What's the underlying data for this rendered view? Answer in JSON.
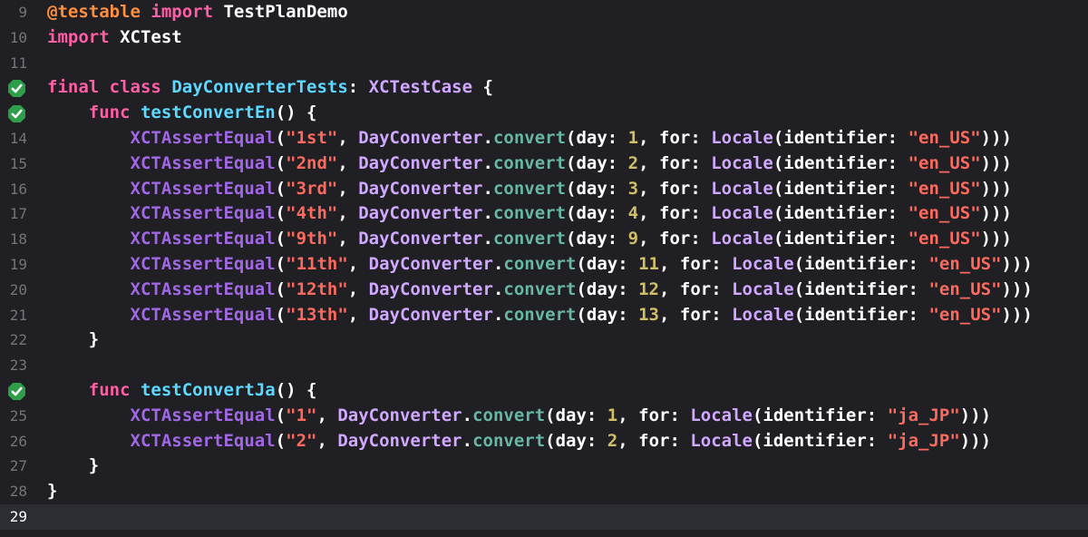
{
  "colors": {
    "keyword": "#fc5fa3",
    "attribute": "#fd8f3f",
    "type_decl": "#5dd8ff",
    "class_ref": "#d0a8ff",
    "method": "#67b7a4",
    "string": "#fc6a5d",
    "number": "#d0bf69",
    "library_fn": "#a167e6",
    "plain": "#ffffff",
    "test_pass_badge": "#2e9e4a"
  },
  "editor": {
    "current_line": 29,
    "lines": [
      {
        "n": "9",
        "tokens": [
          [
            "attr",
            "@testable"
          ],
          [
            "plain",
            " "
          ],
          [
            "kw",
            "import"
          ],
          [
            "plain",
            " TestPlanDemo"
          ]
        ]
      },
      {
        "n": "10",
        "tokens": [
          [
            "kw",
            "import"
          ],
          [
            "plain",
            " XCTest"
          ]
        ]
      },
      {
        "n": "11",
        "tokens": []
      },
      {
        "n": "12",
        "pass_icon": "test-passed-icon",
        "tokens": [
          [
            "kw",
            "final"
          ],
          [
            "plain",
            " "
          ],
          [
            "kw",
            "class"
          ],
          [
            "plain",
            " "
          ],
          [
            "type",
            "DayConverterTests"
          ],
          [
            "plain",
            ": "
          ],
          [
            "cls",
            "XCTestCase"
          ],
          [
            "plain",
            " {"
          ]
        ]
      },
      {
        "n": "13",
        "pass_icon": "test-passed-icon",
        "tokens": [
          [
            "plain",
            "    "
          ],
          [
            "kw",
            "func"
          ],
          [
            "plain",
            " "
          ],
          [
            "type",
            "testConvertEn"
          ],
          [
            "plain",
            "() {"
          ]
        ]
      },
      {
        "n": "14",
        "tokens": [
          [
            "plain",
            "        "
          ],
          [
            "lib",
            "XCTAssertEqual"
          ],
          [
            "plain",
            "("
          ],
          [
            "str",
            "\"1st\""
          ],
          [
            "plain",
            ", "
          ],
          [
            "cls",
            "DayConverter"
          ],
          [
            "plain",
            "."
          ],
          [
            "fn",
            "convert"
          ],
          [
            "plain",
            "(day: "
          ],
          [
            "num",
            "1"
          ],
          [
            "plain",
            ", for: "
          ],
          [
            "cls",
            "Locale"
          ],
          [
            "plain",
            "(identifier: "
          ],
          [
            "str",
            "\"en_US\""
          ],
          [
            "plain",
            ")))"
          ]
        ]
      },
      {
        "n": "15",
        "tokens": [
          [
            "plain",
            "        "
          ],
          [
            "lib",
            "XCTAssertEqual"
          ],
          [
            "plain",
            "("
          ],
          [
            "str",
            "\"2nd\""
          ],
          [
            "plain",
            ", "
          ],
          [
            "cls",
            "DayConverter"
          ],
          [
            "plain",
            "."
          ],
          [
            "fn",
            "convert"
          ],
          [
            "plain",
            "(day: "
          ],
          [
            "num",
            "2"
          ],
          [
            "plain",
            ", for: "
          ],
          [
            "cls",
            "Locale"
          ],
          [
            "plain",
            "(identifier: "
          ],
          [
            "str",
            "\"en_US\""
          ],
          [
            "plain",
            ")))"
          ]
        ]
      },
      {
        "n": "16",
        "tokens": [
          [
            "plain",
            "        "
          ],
          [
            "lib",
            "XCTAssertEqual"
          ],
          [
            "plain",
            "("
          ],
          [
            "str",
            "\"3rd\""
          ],
          [
            "plain",
            ", "
          ],
          [
            "cls",
            "DayConverter"
          ],
          [
            "plain",
            "."
          ],
          [
            "fn",
            "convert"
          ],
          [
            "plain",
            "(day: "
          ],
          [
            "num",
            "3"
          ],
          [
            "plain",
            ", for: "
          ],
          [
            "cls",
            "Locale"
          ],
          [
            "plain",
            "(identifier: "
          ],
          [
            "str",
            "\"en_US\""
          ],
          [
            "plain",
            ")))"
          ]
        ]
      },
      {
        "n": "17",
        "tokens": [
          [
            "plain",
            "        "
          ],
          [
            "lib",
            "XCTAssertEqual"
          ],
          [
            "plain",
            "("
          ],
          [
            "str",
            "\"4th\""
          ],
          [
            "plain",
            ", "
          ],
          [
            "cls",
            "DayConverter"
          ],
          [
            "plain",
            "."
          ],
          [
            "fn",
            "convert"
          ],
          [
            "plain",
            "(day: "
          ],
          [
            "num",
            "4"
          ],
          [
            "plain",
            ", for: "
          ],
          [
            "cls",
            "Locale"
          ],
          [
            "plain",
            "(identifier: "
          ],
          [
            "str",
            "\"en_US\""
          ],
          [
            "plain",
            ")))"
          ]
        ]
      },
      {
        "n": "18",
        "tokens": [
          [
            "plain",
            "        "
          ],
          [
            "lib",
            "XCTAssertEqual"
          ],
          [
            "plain",
            "("
          ],
          [
            "str",
            "\"9th\""
          ],
          [
            "plain",
            ", "
          ],
          [
            "cls",
            "DayConverter"
          ],
          [
            "plain",
            "."
          ],
          [
            "fn",
            "convert"
          ],
          [
            "plain",
            "(day: "
          ],
          [
            "num",
            "9"
          ],
          [
            "plain",
            ", for: "
          ],
          [
            "cls",
            "Locale"
          ],
          [
            "plain",
            "(identifier: "
          ],
          [
            "str",
            "\"en_US\""
          ],
          [
            "plain",
            ")))"
          ]
        ]
      },
      {
        "n": "19",
        "tokens": [
          [
            "plain",
            "        "
          ],
          [
            "lib",
            "XCTAssertEqual"
          ],
          [
            "plain",
            "("
          ],
          [
            "str",
            "\"11th\""
          ],
          [
            "plain",
            ", "
          ],
          [
            "cls",
            "DayConverter"
          ],
          [
            "plain",
            "."
          ],
          [
            "fn",
            "convert"
          ],
          [
            "plain",
            "(day: "
          ],
          [
            "num",
            "11"
          ],
          [
            "plain",
            ", for: "
          ],
          [
            "cls",
            "Locale"
          ],
          [
            "plain",
            "(identifier: "
          ],
          [
            "str",
            "\"en_US\""
          ],
          [
            "plain",
            ")))"
          ]
        ]
      },
      {
        "n": "20",
        "tokens": [
          [
            "plain",
            "        "
          ],
          [
            "lib",
            "XCTAssertEqual"
          ],
          [
            "plain",
            "("
          ],
          [
            "str",
            "\"12th\""
          ],
          [
            "plain",
            ", "
          ],
          [
            "cls",
            "DayConverter"
          ],
          [
            "plain",
            "."
          ],
          [
            "fn",
            "convert"
          ],
          [
            "plain",
            "(day: "
          ],
          [
            "num",
            "12"
          ],
          [
            "plain",
            ", for: "
          ],
          [
            "cls",
            "Locale"
          ],
          [
            "plain",
            "(identifier: "
          ],
          [
            "str",
            "\"en_US\""
          ],
          [
            "plain",
            ")))"
          ]
        ]
      },
      {
        "n": "21",
        "tokens": [
          [
            "plain",
            "        "
          ],
          [
            "lib",
            "XCTAssertEqual"
          ],
          [
            "plain",
            "("
          ],
          [
            "str",
            "\"13th\""
          ],
          [
            "plain",
            ", "
          ],
          [
            "cls",
            "DayConverter"
          ],
          [
            "plain",
            "."
          ],
          [
            "fn",
            "convert"
          ],
          [
            "plain",
            "(day: "
          ],
          [
            "num",
            "13"
          ],
          [
            "plain",
            ", for: "
          ],
          [
            "cls",
            "Locale"
          ],
          [
            "plain",
            "(identifier: "
          ],
          [
            "str",
            "\"en_US\""
          ],
          [
            "plain",
            ")))"
          ]
        ]
      },
      {
        "n": "22",
        "tokens": [
          [
            "plain",
            "    }"
          ]
        ]
      },
      {
        "n": "23",
        "tokens": []
      },
      {
        "n": "24",
        "pass_icon": "test-passed-icon",
        "tokens": [
          [
            "plain",
            "    "
          ],
          [
            "kw",
            "func"
          ],
          [
            "plain",
            " "
          ],
          [
            "type",
            "testConvertJa"
          ],
          [
            "plain",
            "() {"
          ]
        ]
      },
      {
        "n": "25",
        "tokens": [
          [
            "plain",
            "        "
          ],
          [
            "lib",
            "XCTAssertEqual"
          ],
          [
            "plain",
            "("
          ],
          [
            "str",
            "\"1\""
          ],
          [
            "plain",
            ", "
          ],
          [
            "cls",
            "DayConverter"
          ],
          [
            "plain",
            "."
          ],
          [
            "fn",
            "convert"
          ],
          [
            "plain",
            "(day: "
          ],
          [
            "num",
            "1"
          ],
          [
            "plain",
            ", for: "
          ],
          [
            "cls",
            "Locale"
          ],
          [
            "plain",
            "(identifier: "
          ],
          [
            "str",
            "\"ja_JP\""
          ],
          [
            "plain",
            ")))"
          ]
        ]
      },
      {
        "n": "26",
        "tokens": [
          [
            "plain",
            "        "
          ],
          [
            "lib",
            "XCTAssertEqual"
          ],
          [
            "plain",
            "("
          ],
          [
            "str",
            "\"2\""
          ],
          [
            "plain",
            ", "
          ],
          [
            "cls",
            "DayConverter"
          ],
          [
            "plain",
            "."
          ],
          [
            "fn",
            "convert"
          ],
          [
            "plain",
            "(day: "
          ],
          [
            "num",
            "2"
          ],
          [
            "plain",
            ", for: "
          ],
          [
            "cls",
            "Locale"
          ],
          [
            "plain",
            "(identifier: "
          ],
          [
            "str",
            "\"ja_JP\""
          ],
          [
            "plain",
            ")))"
          ]
        ]
      },
      {
        "n": "27",
        "tokens": [
          [
            "plain",
            "    }"
          ]
        ]
      },
      {
        "n": "28",
        "tokens": [
          [
            "plain",
            "}"
          ]
        ]
      },
      {
        "n": "29",
        "tokens": []
      }
    ]
  }
}
